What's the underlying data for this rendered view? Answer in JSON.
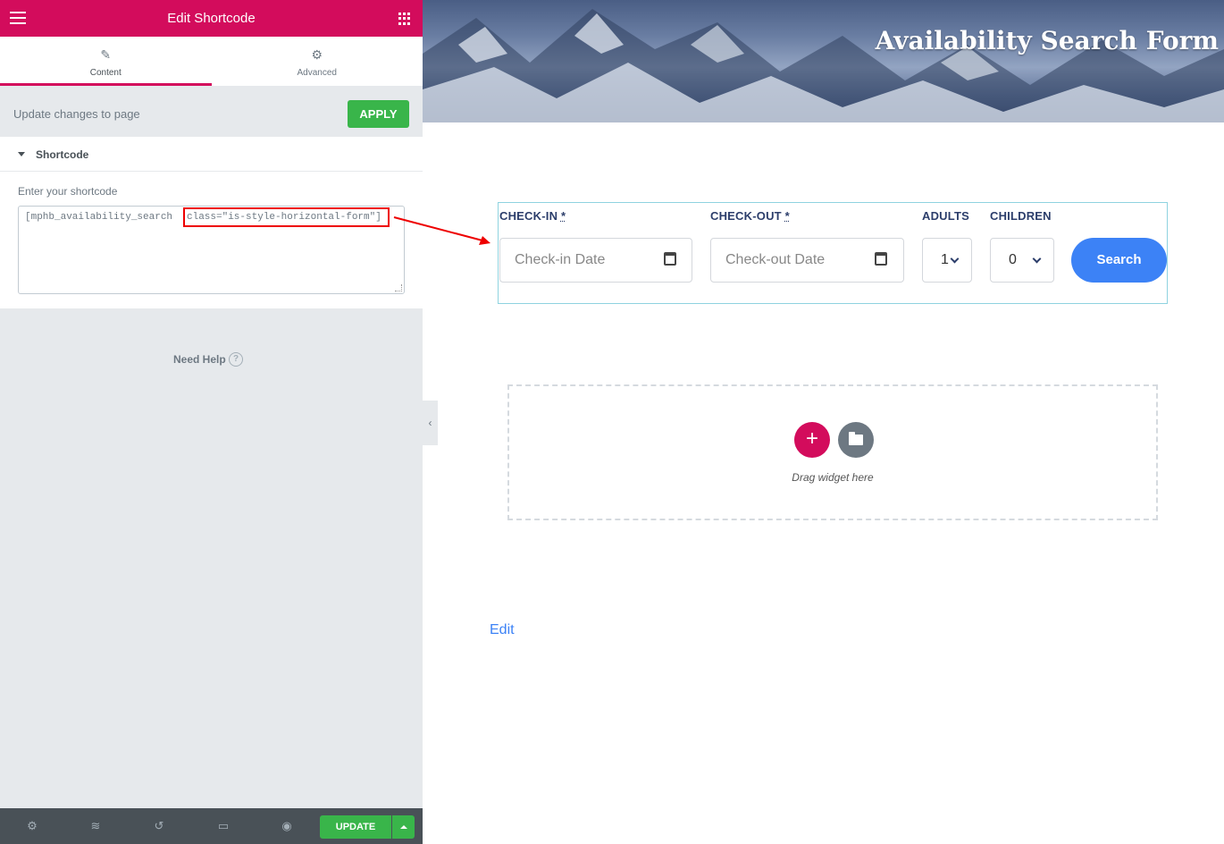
{
  "panel": {
    "title": "Edit Shortcode",
    "tabs": [
      {
        "label": "Content",
        "icon": "pencil-icon"
      },
      {
        "label": "Advanced",
        "icon": "gear-icon"
      }
    ],
    "update_text": "Update changes to page",
    "apply_label": "APPLY",
    "section_title": "Shortcode",
    "field_label": "Enter your shortcode",
    "shortcode_prefix": "[mphb_availability_search",
    "shortcode_highlight": "class=\"is-style-horizontal-form\"",
    "shortcode_suffix": "]",
    "need_help": "Need Help",
    "update_label": "UPDATE",
    "accent": "#d30c5c",
    "green": "#39b54a"
  },
  "preview": {
    "hero_title": "Availability Search Form",
    "form": {
      "checkin_label": "CHECK-IN",
      "checkout_label": "CHECK-OUT",
      "required_mark": "*",
      "adults_label": "ADULTS",
      "children_label": "CHILDREN",
      "checkin_placeholder": "Check-in Date",
      "checkout_placeholder": "Check-out Date",
      "adults_value": "1",
      "children_value": "0",
      "search_label": "Search",
      "button_color": "#3c82f6"
    },
    "drag_text": "Drag widget here",
    "edit_link": "Edit"
  }
}
